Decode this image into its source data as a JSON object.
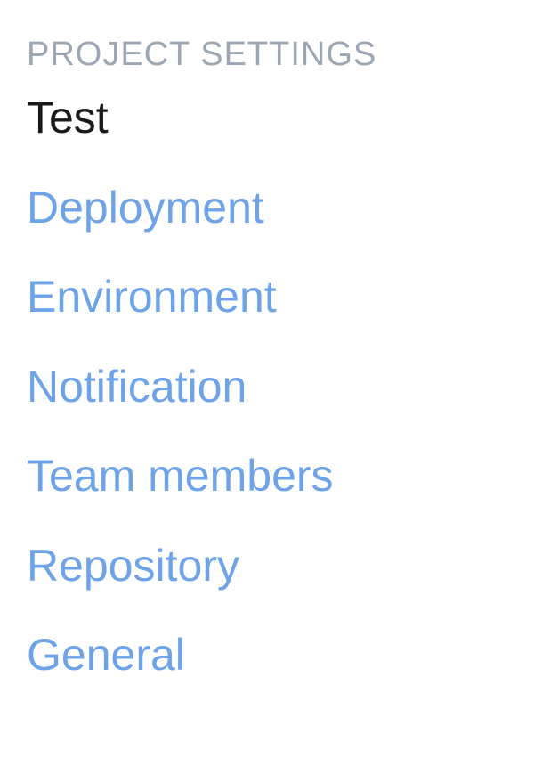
{
  "sidebar": {
    "header": "PROJECT SETTINGS",
    "items": [
      {
        "label": "Test",
        "active": true
      },
      {
        "label": "Deployment",
        "active": false
      },
      {
        "label": "Environment",
        "active": false
      },
      {
        "label": "Notification",
        "active": false
      },
      {
        "label": "Team members",
        "active": false
      },
      {
        "label": "Repository",
        "active": false
      },
      {
        "label": "General",
        "active": false
      }
    ]
  }
}
